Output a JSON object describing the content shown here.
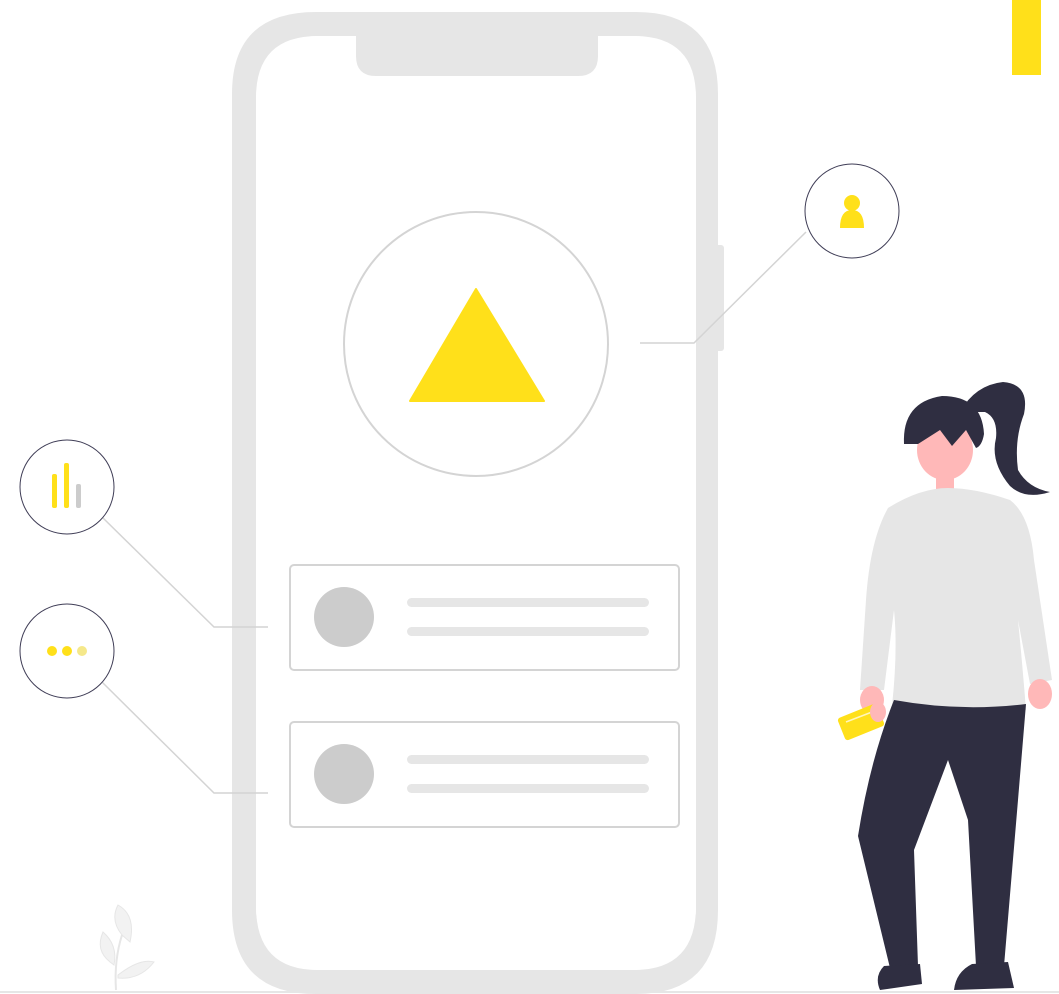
{
  "illustration": {
    "description_free": true,
    "colors": {
      "accent": "#FFE01A",
      "accent_dark": "#F5D20A",
      "phone_frame": "#E6E6E6",
      "outline": "#D4D4D4",
      "circle_outline": "#3F3D56",
      "placeholder_gray": "#CCCCCC",
      "line_gray": "#E6E6E6",
      "hair": "#2F2E41",
      "skin": "#FFB8B8",
      "sweater": "#E6E6E6",
      "pants": "#2F2E41"
    },
    "icons": {
      "top_right": "user-icon",
      "left_top": "bar-chart-icon",
      "left_bottom": "more-dots-icon",
      "center": "triangle-logo-icon"
    },
    "cards": [
      {
        "avatar": "placeholder-avatar",
        "lines": 2
      },
      {
        "avatar": "placeholder-avatar",
        "lines": 2
      }
    ]
  }
}
